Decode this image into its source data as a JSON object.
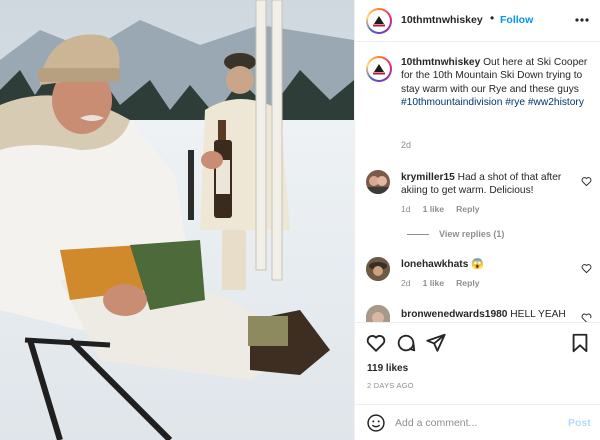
{
  "colors": {
    "accent": "#0095f6",
    "hashtag": "#00376b",
    "muted": "#8e8e8e",
    "text": "#262626"
  },
  "post": {
    "photo_label": "photo-of-two-men-in-snow",
    "header": {
      "username": "10thmtnwhiskey",
      "dot": "•",
      "follow_label": "Follow",
      "more_icon": "ellipsis-icon"
    },
    "caption": {
      "username": "10thmtnwhiskey",
      "text": "Out here at Ski Cooper for the 10th Mountain Ski Down trying to stay warm with our Rye and these guys",
      "hashtags": "#10thmountaindivision #rye #ww2history",
      "time": "2d"
    },
    "comments": [
      {
        "username": "krymiller15",
        "text": "Had a shot of that after akiing to get warm. Delicious!",
        "time": "1d",
        "likes": "1 like",
        "reply": "Reply",
        "view_replies": "View replies (1)"
      },
      {
        "username": "lonehawkhats",
        "text": "😱",
        "time": "2d",
        "likes": "1 like",
        "reply": "Reply"
      },
      {
        "username": "bronwenedwards1980",
        "text": "HELL YEAH"
      }
    ],
    "actions": {
      "like_icon": "heart-icon",
      "comment_icon": "comment-icon",
      "share_icon": "share-icon",
      "save_icon": "bookmark-icon"
    },
    "likes_text": "119 likes",
    "date_text": "2 DAYS AGO",
    "add_comment": {
      "placeholder": "Add a comment...",
      "post_label": "Post",
      "emoji_icon": "smiley-icon"
    }
  }
}
